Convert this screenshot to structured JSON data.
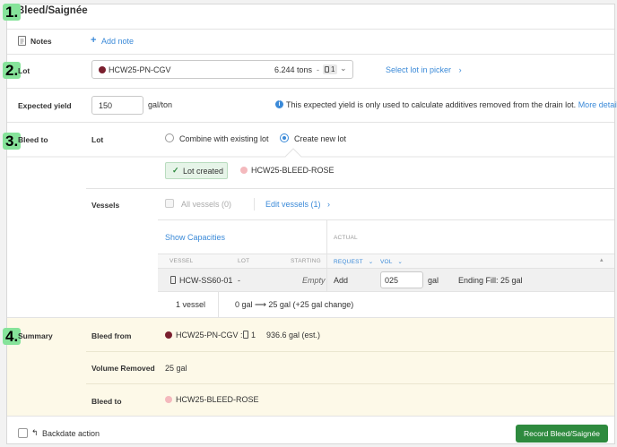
{
  "title": "Bleed/Saignée",
  "notes": {
    "label": "Notes",
    "add_note": "Add note"
  },
  "lot": {
    "label": "Lot",
    "selected": "HCW25-PN-CGV",
    "selected_color": "#7a1f2e",
    "quantity": "6.244 tons",
    "vessel_count": "1",
    "select_in_picker": "Select lot in picker"
  },
  "expected_yield": {
    "label": "Expected yield",
    "value": "150",
    "unit": "gal/ton",
    "info": "This expected yield is only used to calculate additives removed from the drain lot.",
    "more_details": "More details."
  },
  "bleed_to": {
    "label": "Bleed to",
    "lot_label": "Lot",
    "option_combine": "Combine with existing lot",
    "option_create": "Create new lot",
    "selected_option": "create",
    "lot_created_badge": "Lot created",
    "new_lot_name": "HCW25-BLEED-ROSE",
    "new_lot_color": "#f4b9bd"
  },
  "vessels": {
    "label": "Vessels",
    "all_vessels": "All vessels (0)",
    "edit_vessels": "Edit vessels (1)",
    "show_capacities": "Show Capacities",
    "actual_header": "ACTUAL",
    "columns": {
      "vessel": "VESSEL",
      "lot": "LOT",
      "starting": "STARTING",
      "request": "REQUEST",
      "vol": "VOL"
    },
    "row": {
      "vessel": "HCW-SS60-01",
      "lot": "-",
      "starting": "Empty",
      "request": "Add",
      "volume": "025",
      "unit": "gal",
      "ending_fill": "Ending Fill: 25 gal"
    },
    "footer_count": "1 vessel",
    "footer_change": "0 gal ⟶ 25 gal (+25 gal change)"
  },
  "summary": {
    "label": "Summary",
    "bleed_from_label": "Bleed from",
    "bleed_from_lot": "HCW25-PN-CGV :",
    "bleed_from_vessels": "1",
    "bleed_from_volume": "936.6 gal (est.)",
    "volume_removed_label": "Volume Removed",
    "volume_removed": "25 gal",
    "bleed_to_label": "Bleed to",
    "bleed_to_lot": "HCW25-BLEED-ROSE"
  },
  "footer": {
    "backdate_action": "Backdate action",
    "record_button": "Record Bleed/Saignée"
  },
  "step_badges": [
    "1.",
    "2.",
    "3.",
    "4."
  ],
  "colors": {
    "accent": "#3b8ad8",
    "primary_button": "#2e8a3e",
    "summary_bg": "#fdf9e8",
    "badge_bg": "#86e39a"
  }
}
